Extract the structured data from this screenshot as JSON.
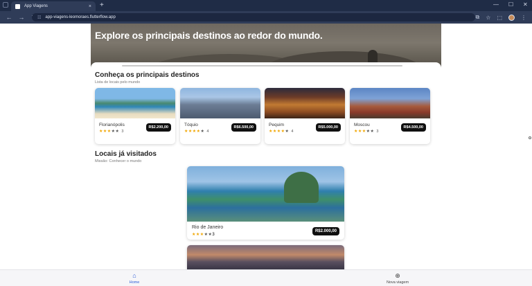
{
  "browser": {
    "tab_title": "App Viagens",
    "tab_close": "×",
    "new_tab": "+",
    "url": "app-viagens-leomoraes.flutterflow.app",
    "window_controls": [
      "—",
      "☐",
      "✕"
    ],
    "icons": [
      "tablist-icon",
      "back-icon",
      "forward-icon",
      "reload-icon",
      "site-info-icon",
      "install-app-icon",
      "star-icon",
      "extensions-icon",
      "profile-icon",
      "menu-icon"
    ]
  },
  "hero": {
    "title": "Explore os principais destinos ao redor do mundo."
  },
  "top_destinations": {
    "title": "Conheça os principais destinos",
    "subtitle": "Lista de locais pelo mundo",
    "items": [
      {
        "name": "Florianópolis",
        "rating": 3,
        "rating_label": "3",
        "price": "R$2.200,00"
      },
      {
        "name": "Tóquio",
        "rating": 4,
        "rating_label": "4",
        "price": "R$6.500,00"
      },
      {
        "name": "Pequim",
        "rating": 4,
        "rating_label": "4",
        "price": "R$5.000,00"
      },
      {
        "name": "Moscou",
        "rating": 3,
        "rating_label": "3",
        "price": "R$4.500,00"
      }
    ]
  },
  "visited": {
    "title": "Locais já visitados",
    "subtitle": "Missão: Conhecer o mundo",
    "items": [
      {
        "name": "Rio de Janeiro",
        "rating": 3,
        "rating_label": "3",
        "price": "R$2.000,00"
      }
    ]
  },
  "bottom_nav": {
    "home_label": "Home",
    "new_trip_label": "Nova viagem"
  },
  "colors": {
    "accent": "#2a5bd7",
    "star": "#f0a500",
    "price_badge": "#101010"
  }
}
